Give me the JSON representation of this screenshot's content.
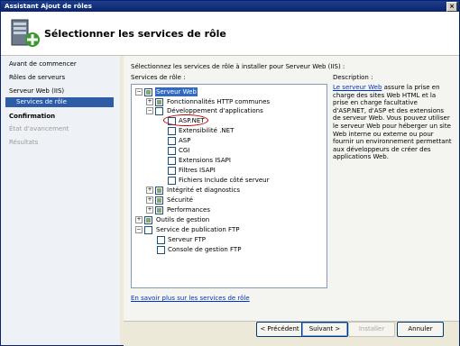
{
  "window": {
    "title": "Assistant Ajout de rôles",
    "close_glyph": "×"
  },
  "header": {
    "title": "Sélectionner les services de rôle"
  },
  "sidebar": {
    "items": [
      {
        "label": "Avant de commencer",
        "state": "normal"
      },
      {
        "label": "Rôles de serveurs",
        "state": "normal"
      },
      {
        "label": "Serveur Web (IIS)",
        "state": "normal"
      },
      {
        "label": "Services de rôle",
        "state": "selected"
      },
      {
        "label": "Confirmation",
        "state": "bold"
      },
      {
        "label": "État d'avancement",
        "state": "disabled"
      },
      {
        "label": "Résultats",
        "state": "disabled"
      }
    ]
  },
  "main": {
    "intro": "Sélectionnez les services de rôle à installer pour Serveur Web (IIS) :",
    "services_label": "Services de rôle :",
    "tree": [
      {
        "label": "Serveur Web",
        "expander": "−",
        "check": "partial",
        "selected": true
      },
      {
        "label": "Fonctionnalités HTTP communes",
        "expander": "+",
        "check": "partial"
      },
      {
        "label": "Développement d'applications",
        "expander": "−",
        "check": "none"
      },
      {
        "label": "ASP.NET",
        "check": "none"
      },
      {
        "label": "Extensibilité .NET",
        "check": "none"
      },
      {
        "label": "ASP",
        "check": "none"
      },
      {
        "label": "CGI",
        "check": "none"
      },
      {
        "label": "Extensions ISAPI",
        "check": "none"
      },
      {
        "label": "Filtres ISAPI",
        "check": "none"
      },
      {
        "label": "Fichiers Include côté serveur",
        "check": "none"
      },
      {
        "label": "Intégrité et diagnostics",
        "expander": "+",
        "check": "partial"
      },
      {
        "label": "Sécurité",
        "expander": "+",
        "check": "partial"
      },
      {
        "label": "Performances",
        "expander": "+",
        "check": "partial"
      },
      {
        "label": "Outils de gestion",
        "expander": "+",
        "check": "partial"
      },
      {
        "label": "Service de publication FTP",
        "expander": "−",
        "check": "none"
      },
      {
        "label": "Serveur FTP",
        "check": "none"
      },
      {
        "label": "Console de gestion FTP",
        "check": "none"
      }
    ],
    "more_link": "En savoir plus sur les services de rôle"
  },
  "description": {
    "heading": "Description :",
    "link": "Le serveur Web",
    "text": " assure la prise en charge des sites Web HTML et la prise en charge facultative d'ASP.NET, d'ASP et des extensions de serveur Web. Vous pouvez utiliser le serveur Web pour héberger un site Web interne ou externe ou pour fournir un environnement permettant aux développeurs de créer des applications Web."
  },
  "buttons": {
    "previous": "< Précédent",
    "next": "Suivant >",
    "install": "Installer",
    "cancel": "Annuler"
  },
  "colors": {
    "accent": "#2f5ca6",
    "link": "#0033cc",
    "annotation": "#c00000"
  }
}
